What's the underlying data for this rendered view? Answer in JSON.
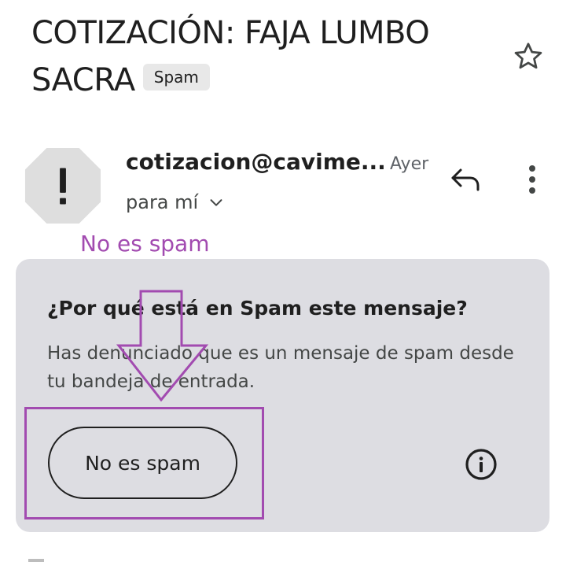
{
  "message": {
    "subject": "COTIZACIÓN: FAJA LUMBO SACRA",
    "label_badge": "Spam",
    "sender": "cotizacion@cavime...",
    "date": "Ayer",
    "recipient": "para mí",
    "avatar_symbol": "!"
  },
  "annotation": {
    "label": "No es spam",
    "color": "#a24bb0"
  },
  "spam_card": {
    "title": "¿Por qué está en Spam este mensaje?",
    "description": "Has denunciado que es un mensaje de spam desde tu bandeja de entrada.",
    "button_label": "No es spam",
    "background": "#dddde2"
  },
  "icons": {
    "star": "star-outline-icon",
    "reply": "reply-icon",
    "more": "more-vert-icon",
    "chevron": "chevron-down-icon",
    "info": "info-icon",
    "avatar": "warning-octagon-icon"
  }
}
